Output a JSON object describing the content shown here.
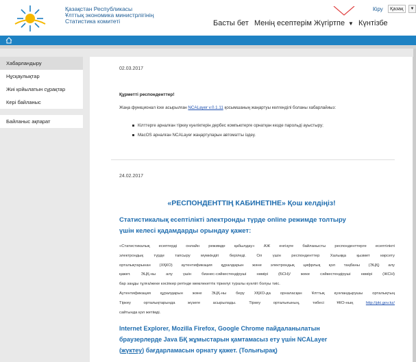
{
  "header": {
    "org_lines": [
      "Қазақстан Республикасы",
      "Ұлттық экономика министрлігінің",
      "Статистика комитеті"
    ],
    "login": "Кіру",
    "language": "Қазақ",
    "nav": [
      "Басты бет",
      "Менің есептерім",
      "Жүгіртпе",
      "Күнтізбе"
    ]
  },
  "sidebar": {
    "group1": [
      "Хабарландыру",
      "Нұсқаулықтар",
      "Жиі қойылатын сұрақтар",
      "Кері байланыс"
    ],
    "group2": [
      "Байланыс ақпарат"
    ]
  },
  "news1": {
    "date": "02.03.2017",
    "greeting": "Құрметті респонденттер!",
    "intro_pre": "Жаңа функционал іске асырылған",
    "intro_link": "NCALayer v.0.1.11",
    "intro_post": "қосымшаның жаңартуы келгенділі боланы хабарлайиыз:",
    "bullets": [
      "Кілттерге арналған тіркеу куәліктерін дербес компьютерге орнатқан кезде парольді ауыстыру;",
      "MacOS арналған NCALayer жаңартуларын автоматты іздеу."
    ]
  },
  "news2": {
    "date": "24.02.2017",
    "welcome": "«РЕСПОНДЕНТТІҢ КАБИНЕТІНЕ» Қош келдіңіз!",
    "subtitle": [
      "Статистикалық есептілікті электронды түрде online режимде толтыру",
      "үшін келесі қадамдарды орындау қажет:"
    ],
    "para": [
      "«Статистикалық есептерді онлайн режимде қабылдау» АЖ енгізуге байланысты респонденттерге есептілікті",
      "электрондық түрде тапсыру мүмкіндігі беріледі. Ол үшін респонденттер Халыққа қызмет көрсету",
      "орталықтарынан (ХҚКО) аутентификация құралдарын және электрондық цифрлық қол таңбаны (ЭЦҚ) алу",
      "қажет. ЭЦҚ-ны алу үшін бизнес-сәйкестендіруші нөмірі (БСН)/ жеке сәйкестендіруші нөмірі (ЖСН)",
      "бар заңды тұлға/жеке кәсіпкер ретінде мемлекеттік тіркелуі туралы куәлігі болуы тиіс.",
      "Аутентификация құралдарын және ЭЦҚ-ны беру ХҚКО-да орналасқан Ұлттық куәландырушы орталықтың",
      "Тіркеу орталықтарында жүзеге асырылады. Тіркеу орталығының, төбесі ҰКО-ның",
      "сайтында қол жетімді."
    ],
    "pki_link": "http://pki.gov.kz/",
    "heading2": [
      "Internet Explorer, Mozilla Firefox, Google Chrome пайдаланылатын",
      "браузерлерде Java БҚ жұмыстарын қамтамасыз ету үшін NCALayer"
    ],
    "heading2_link": "жүктеу",
    "heading2_post": ") бағдарламасын орнату қажет. (Толығырақ)"
  },
  "colors": {
    "brand_blue": "#1e82c3",
    "heading_blue": "#1e6cae",
    "link": "#1d4faf"
  }
}
